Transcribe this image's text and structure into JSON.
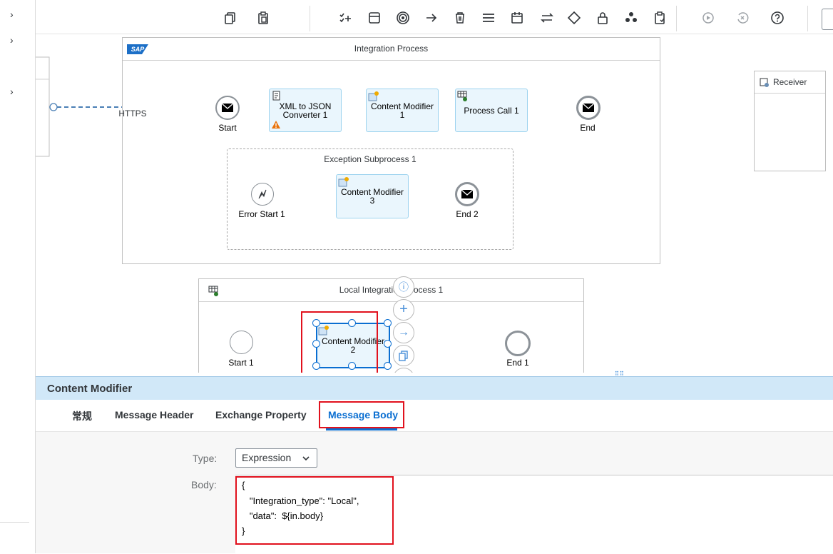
{
  "canvas": {
    "integration_process": {
      "title": "Integration Process",
      "logo": "SAP",
      "connection_label": "HTTPS",
      "steps": [
        {
          "name": "XML to JSON Converter 1",
          "line1": "XML to JSON",
          "line2": "Converter 1"
        },
        {
          "name": "Content Modifier 1",
          "line1": "Content Modifier",
          "line2": "1"
        },
        {
          "name": "Process Call 1",
          "line1": "Process Call 1",
          "line2": ""
        }
      ],
      "start_label": "Start",
      "end_label": "End"
    },
    "exception_subprocess": {
      "title": "Exception Subprocess 1",
      "error_start_label": "Error Start 1",
      "step": {
        "line1": "Content Modifier",
        "line2": "3"
      },
      "end_label": "End 2"
    },
    "local_process": {
      "title": "Local Integration Process 1",
      "start_label": "Start 1",
      "step": {
        "line1": "Content Modifier",
        "line2": "2"
      },
      "end_label": "End 1"
    },
    "receiver": {
      "label": "Receiver"
    }
  },
  "toolbar": {
    "icons": [
      "copy-icon",
      "paste-icon",
      "checklist-add-icon",
      "panel-icon",
      "target-icon",
      "arrow-right-icon",
      "delete-icon",
      "menu-icon",
      "calendar-icon",
      "swap-icon",
      "diamond-icon",
      "lock-icon",
      "cube-icon",
      "clipboard-check-icon",
      "play-icon",
      "cancel-icon",
      "help-icon"
    ]
  },
  "panel": {
    "title": "Content Modifier",
    "tabs": [
      "常规",
      "Message Header",
      "Exchange Property",
      "Message Body"
    ],
    "active_tab": "Message Body",
    "type_label": "Type:",
    "type_value": "Expression",
    "body_label": "Body:",
    "body_lines": [
      "{",
      "   \"Integration_type\": \"Local\",",
      "   \"data\":  ${in.body}",
      "}"
    ]
  },
  "colors": {
    "accent": "#0a6ed1",
    "highlight": "#e1111d",
    "step_fill": "#eaf6fd",
    "panel_header": "#d1e8f8"
  }
}
